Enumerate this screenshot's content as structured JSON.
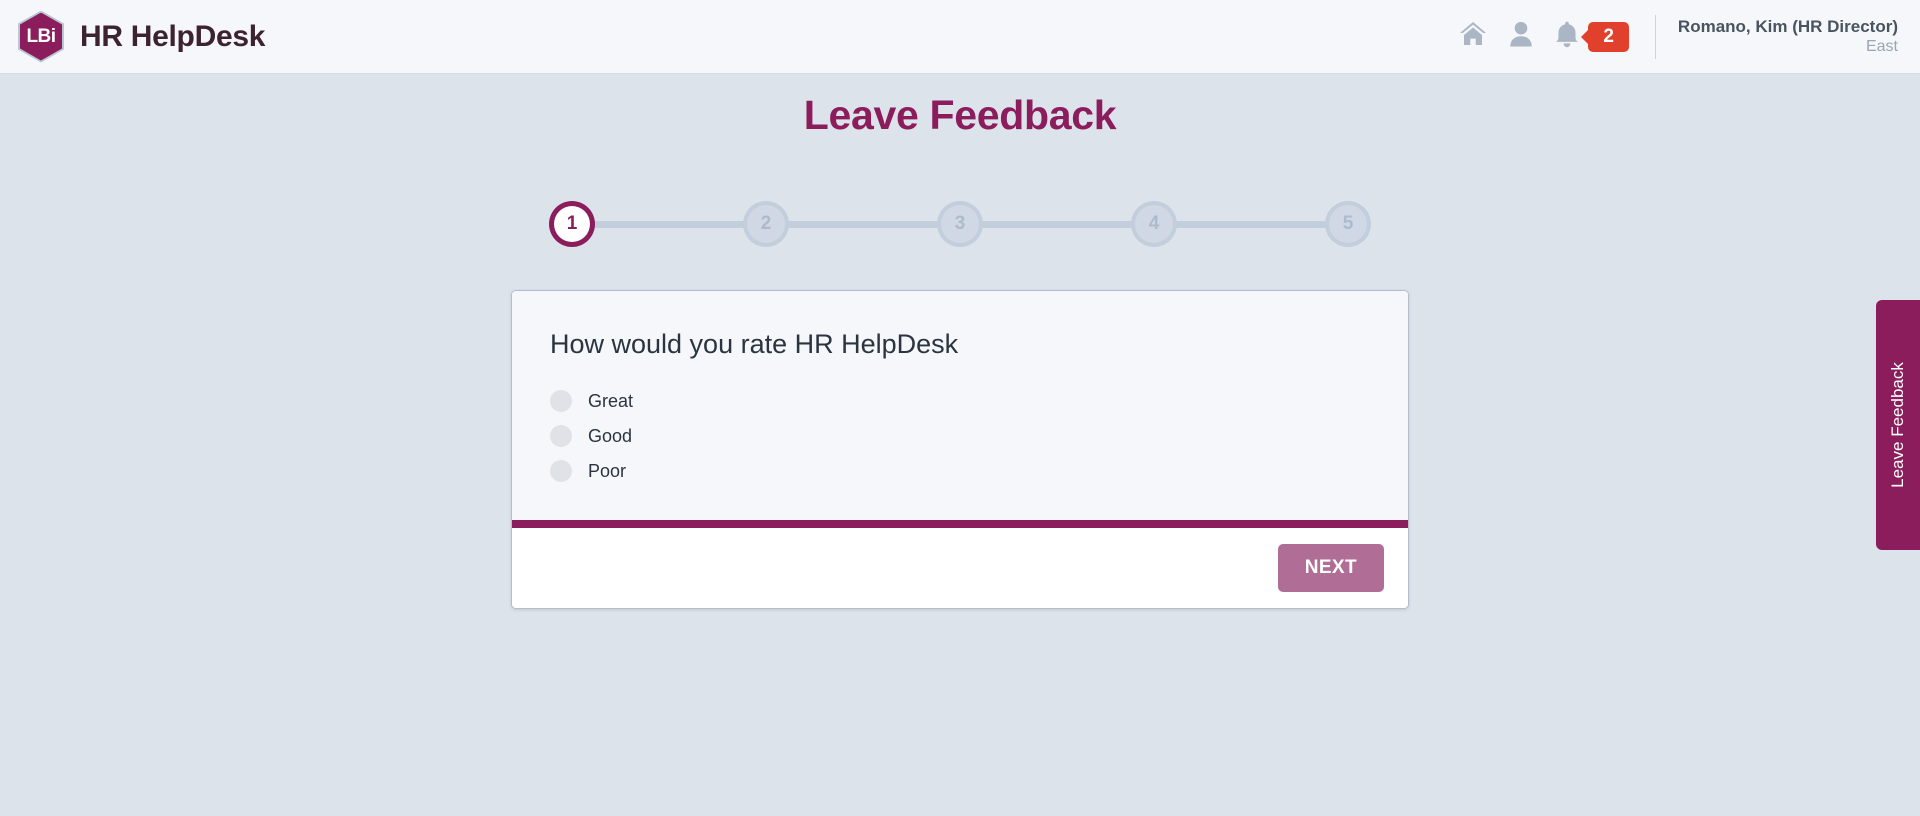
{
  "header": {
    "logo_text": "LBi",
    "logo_icon": "hexagon-logo-icon",
    "brand_name": "HR HelpDesk",
    "icons": [
      {
        "name": "home-icon",
        "label": "Home"
      },
      {
        "name": "user-icon",
        "label": "Profile"
      },
      {
        "name": "bell-icon",
        "label": "Notifications"
      }
    ],
    "notification_count": "2",
    "user_name": "Romano, Kim (HR Director)",
    "user_region": "East"
  },
  "page": {
    "title": "Leave Feedback"
  },
  "stepper": {
    "current_step": 1,
    "steps": [
      {
        "number": "1",
        "state": "active"
      },
      {
        "number": "2",
        "state": "inactive"
      },
      {
        "number": "3",
        "state": "inactive"
      },
      {
        "number": "4",
        "state": "inactive"
      },
      {
        "number": "5",
        "state": "inactive"
      }
    ]
  },
  "card": {
    "question": "How would you rate HR HelpDesk",
    "options": [
      {
        "label": "Great",
        "selected": false
      },
      {
        "label": "Good",
        "selected": false
      },
      {
        "label": "Poor",
        "selected": false
      }
    ],
    "next_label": "NEXT"
  },
  "side_tab": {
    "label": "Leave Feedback"
  },
  "colors": {
    "brand_maroon": "#8b1d5c",
    "badge_red": "#e0402c",
    "page_background": "#dde3ea",
    "header_background": "#f5f7fa",
    "card_body_background": "#f5f7fa",
    "next_button": "#b06e96",
    "stepper_inactive": "#c3cedd"
  }
}
